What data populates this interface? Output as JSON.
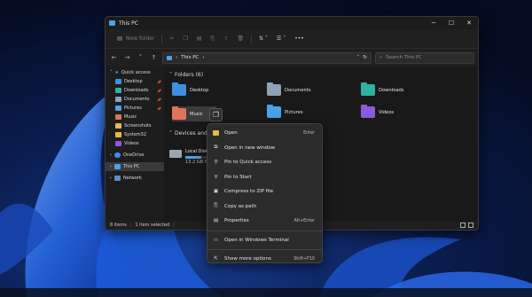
{
  "window": {
    "title": "This PC",
    "min": "─",
    "max": "☐",
    "close": "✕"
  },
  "toolbar": {
    "new_folder": "New folder"
  },
  "address": {
    "path": "This PC",
    "search_placeholder": "Search This PC"
  },
  "sidebar": {
    "quick_access": "Quick access",
    "items": [
      "Desktop",
      "Downloads",
      "Documents",
      "Pictures",
      "Music",
      "Screenshots",
      "System32",
      "Videos"
    ],
    "onedrive": "OneDrive",
    "thispc": "This PC",
    "network": "Network"
  },
  "main": {
    "folders_header": "Folders (6)",
    "folders": [
      "Desktop",
      "Documents",
      "Downloads",
      "Music",
      "Pictures",
      "Videos"
    ],
    "devices_header": "Devices and dri",
    "drive_name": "Local Disk",
    "drive_free": "13.2 GB fr",
    "drive_usage": 0.45
  },
  "status": {
    "items": "8 items",
    "selected": "1 item selected"
  },
  "context_menu": {
    "items": [
      {
        "label": "Open",
        "shortcut": "Enter"
      },
      {
        "label": "Open in new window",
        "shortcut": ""
      },
      {
        "label": "Pin to Quick access",
        "shortcut": ""
      },
      {
        "label": "Pin to Start",
        "shortcut": ""
      },
      {
        "label": "Compress to ZIP file",
        "shortcut": ""
      },
      {
        "label": "Copy as path",
        "shortcut": ""
      },
      {
        "label": "Properties",
        "shortcut": "Alt+Enter"
      },
      {
        "label": "Open in Windows Terminal",
        "shortcut": ""
      },
      {
        "label": "Show more options",
        "shortcut": "Shift+F10"
      }
    ]
  },
  "colors": {
    "accent": "#4ea0e6",
    "folder_yellow": "#e8b84a",
    "downloads": "#2fb3a0",
    "music": "#e0745a",
    "videos": "#8a5ad8",
    "wallpaper_blue": "#1c5bd8"
  }
}
